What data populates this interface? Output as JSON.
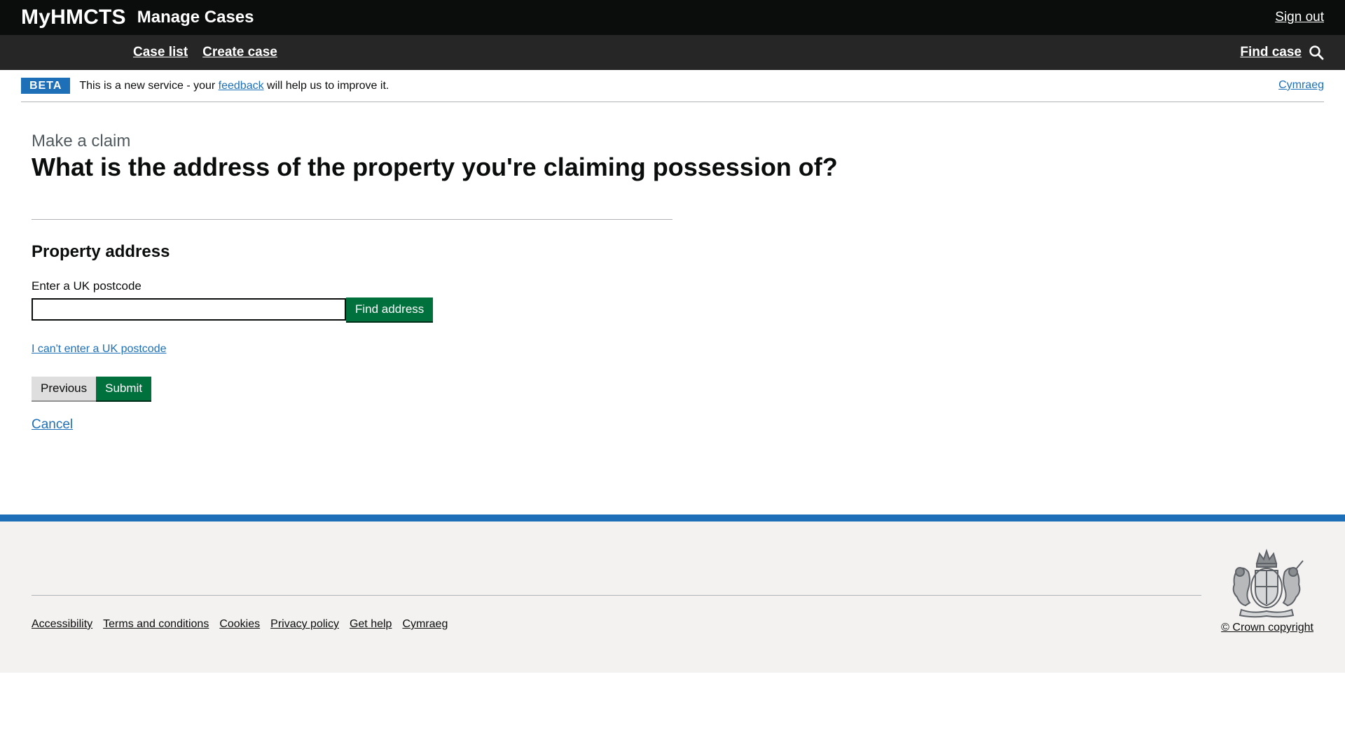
{
  "header": {
    "brand": "MyHMCTS",
    "service_name": "Manage Cases",
    "sign_out": "Sign out"
  },
  "nav": {
    "items": [
      {
        "label": "Case list"
      },
      {
        "label": "Create case"
      }
    ],
    "find_case": "Find case",
    "search_icon": "search-icon"
  },
  "beta_banner": {
    "tag": "BETA",
    "text_before": "This is a new service - your ",
    "feedback_link": "feedback",
    "text_after": " will help us to improve it.",
    "welsh_link": "Cymraeg"
  },
  "main": {
    "caption": "Make a claim",
    "title": "What is the address of the property you're claiming possession of?",
    "section_heading": "Property address",
    "postcode_label": "Enter a UK postcode",
    "postcode_value": "",
    "find_address_button": "Find address",
    "manual_address_link": "I can't enter a UK postcode",
    "previous_button": "Previous",
    "submit_button": "Submit",
    "cancel_link": "Cancel"
  },
  "footer": {
    "links": [
      {
        "label": "Accessibility"
      },
      {
        "label": "Terms and conditions"
      },
      {
        "label": "Cookies"
      },
      {
        "label": "Privacy policy"
      },
      {
        "label": "Get help"
      },
      {
        "label": "Cymraeg"
      }
    ],
    "copyright": "© Crown copyright",
    "crest_icon": "royal-coat-of-arms-icon"
  },
  "colors": {
    "header_bg": "#0b0c0c",
    "nav_bg": "#262626",
    "link_blue": "#1d70b8",
    "button_green": "#00703c",
    "button_grey": "#dedede",
    "footer_bg": "#f3f2f1"
  }
}
